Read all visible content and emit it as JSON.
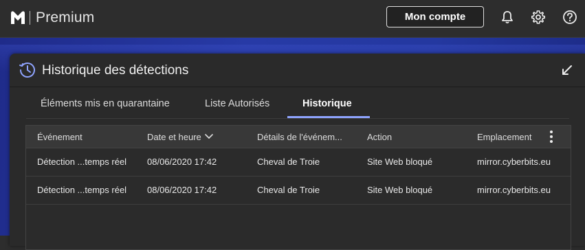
{
  "topbar": {
    "brand": "Premium",
    "account_button": "Mon compte"
  },
  "panel": {
    "title": "Historique des détections",
    "tabs": [
      {
        "label": "Éléments mis en quarantaine"
      },
      {
        "label": "Liste Autorisés"
      },
      {
        "label": "Historique"
      }
    ],
    "active_tab": "Historique"
  },
  "table": {
    "columns": [
      "Événement",
      "Date et heure",
      "Détails de l'événem...",
      "Action",
      "Emplacement"
    ],
    "sorted_column": "Date et heure",
    "rows": [
      [
        "Détection ...temps réel",
        "08/06/2020 17:42",
        "Cheval de Troie",
        "Site Web bloqué",
        "mirror.cyberbits.eu"
      ],
      [
        "Détection ...temps réel",
        "08/06/2020 17:42",
        "Cheval de Troie",
        "Site Web bloqué",
        "mirror.cyberbits.eu"
      ]
    ]
  },
  "icons": {
    "logo": "malwarebytes-logo-icon",
    "notifications": "bell-icon",
    "settings": "gear-icon",
    "help": "help-icon",
    "history": "clock-history-icon",
    "collapse": "collapse-arrow-icon",
    "sort": "chevron-down-icon",
    "more": "more-vertical-icon"
  },
  "colors": {
    "accent": "#8fa4ff",
    "background": "#2d2d2d",
    "backdrop_blue": "#2438a0"
  }
}
